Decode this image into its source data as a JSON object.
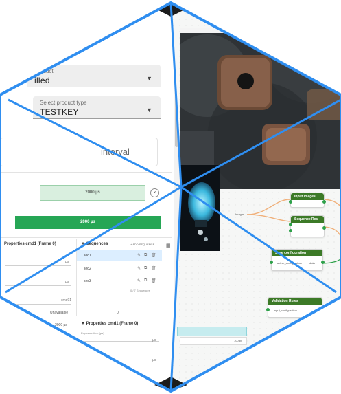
{
  "left_panel": {
    "product_select": {
      "label": "Product",
      "value": "illed"
    },
    "type_select": {
      "label": "Select product type",
      "value": "TESTKEY"
    },
    "interval_card": {
      "text": "interval"
    },
    "duration_box": {
      "value": "2000 µs"
    },
    "run_button": {
      "label": "2000 µs"
    },
    "properties_top": {
      "title": "Properties cmd1 (Frame 0)"
    },
    "unavailable": "Unavailable",
    "units": {
      "us": "µs",
      "cmd": "cmd01"
    },
    "sequences": {
      "title": "Sequences",
      "add_label": "+ ADD SEQUENCE",
      "items": [
        "seq1",
        "seq2",
        "seq3"
      ],
      "footer": "0 / 7 Sequences"
    },
    "properties_bottom": {
      "title": "Properties cmd1 (Frame 0)",
      "field_label": "Exposure time (µs)"
    },
    "bottom_value": "2000 µs"
  },
  "flow": {
    "nodes": [
      {
        "title": "Input Images"
      },
      {
        "title": "Sequence Res"
      },
      {
        "title": "Save configuration"
      },
      {
        "title": "Validation Rules"
      }
    ],
    "input_label": "Images",
    "save_params": [
      "active_configuration",
      "data"
    ],
    "validation_param": "input_configuration",
    "teal_bar_value": "700 px"
  },
  "colors": {
    "accent_blue": "#2f8ef0",
    "run_green": "#26a655",
    "node_green": "#3c7a27",
    "dark_corners": "#1c1c1c"
  }
}
